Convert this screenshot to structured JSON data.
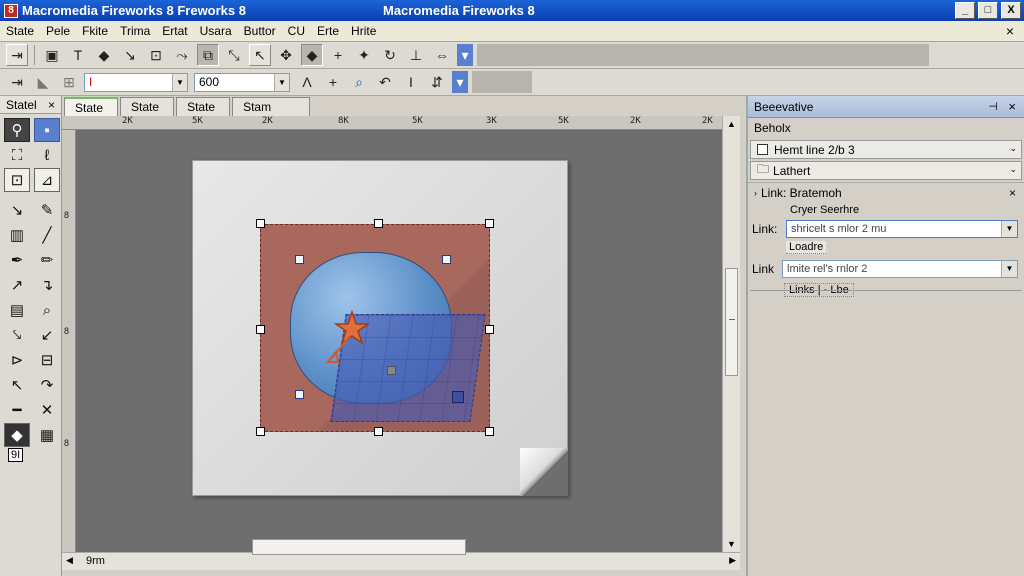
{
  "window": {
    "title_left": "Macromedia Fireworks 8 Freworks 8",
    "title_center": "Macromedia Fireworks 8",
    "app_icon_letter": "8",
    "buttons": [
      "_",
      "□",
      "X"
    ]
  },
  "menubar": {
    "items": [
      "State",
      "Pele",
      "Fkite",
      "Trima",
      "Ertat",
      "Usara",
      "Buttor",
      "CU",
      "Erte",
      "Hrite"
    ],
    "close_glyph": "×"
  },
  "toolbar2": {
    "color_value": "I",
    "size_value": "600"
  },
  "tools_panel": {
    "title": "Statel",
    "close_glyph": "×",
    "bottom_text": "9I"
  },
  "doc_tabs": [
    "State",
    "State",
    "State",
    "Stam"
  ],
  "ruler_labels": [
    "2K",
    "5K",
    "2K",
    "8K",
    "5K",
    "3K",
    "5K",
    "2K",
    "2K"
  ],
  "vruler_labels": [
    "8",
    "8",
    "8"
  ],
  "statusbar": {
    "zoom_text": "9rm"
  },
  "right_panel": {
    "title": "Beeevative",
    "pin_glyph": "⊣",
    "close_glyph": "×",
    "section_label": "Beholx",
    "row1": "Hemt line 2/b 3",
    "row2": "Lathert",
    "row3": "Link: Bratemoh",
    "label_cryer": "Cryer Seerhre",
    "link1_label": "Link:",
    "link1_value": "shricelt s mlor 2 mu",
    "label_loadre": "Loadre",
    "link2_label": "Link",
    "link2_value": "lmite rel's rnlor 2",
    "links_text": "Links | - Lbe"
  },
  "colors": {
    "title_blue": "#0a3fb0",
    "canvas_gray": "#6e6e6e",
    "red_rect": "#a8685e",
    "blob_blue": "#5c8fc8",
    "accent_blue": "#5a7fcf"
  }
}
